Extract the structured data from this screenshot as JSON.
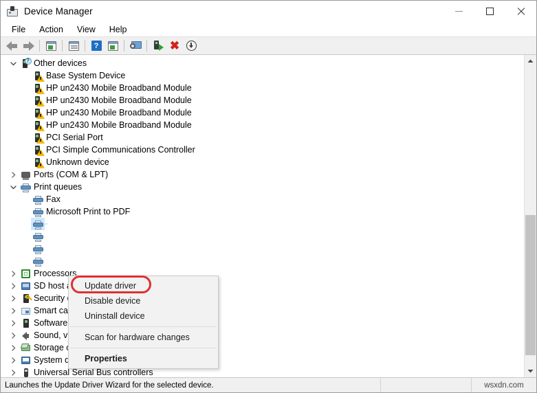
{
  "window": {
    "title": "Device Manager",
    "icon": "device-manager-icon",
    "minimize_label": "Minimize",
    "maximize_label": "Maximize",
    "close_label": "Close"
  },
  "menubar": {
    "items": [
      {
        "label": "File"
      },
      {
        "label": "Action"
      },
      {
        "label": "View"
      },
      {
        "label": "Help"
      }
    ]
  },
  "toolbar": {
    "buttons": [
      {
        "name": "back-arrow-icon",
        "tooltip": "Back"
      },
      {
        "name": "forward-arrow-icon",
        "tooltip": "Forward"
      },
      {
        "name": "show-hide-console-tree-icon",
        "tooltip": "Show/Hide Console Tree"
      },
      {
        "name": "properties-icon",
        "tooltip": "Properties"
      },
      {
        "name": "help-icon",
        "tooltip": "Help"
      },
      {
        "name": "view-icon",
        "tooltip": "View"
      },
      {
        "name": "scan-for-hardware-changes-monitor-icon",
        "tooltip": "Scan for hardware changes"
      },
      {
        "name": "update-driver-icon",
        "tooltip": "Update Driver Software"
      },
      {
        "name": "uninstall-device-icon",
        "tooltip": "Uninstall device"
      },
      {
        "name": "disable-device-icon",
        "tooltip": "Disable device"
      }
    ]
  },
  "tree": {
    "rows": [
      {
        "label": "Other devices",
        "indent": 1,
        "expander": "expanded",
        "icon": "unknown-device-icon",
        "badge": "question"
      },
      {
        "label": "Base System Device",
        "indent": 2,
        "expander": "none",
        "icon": "unknown-device-icon",
        "badge": "warning"
      },
      {
        "label": "HP un2430 Mobile Broadband Module",
        "indent": 2,
        "expander": "none",
        "icon": "unknown-device-icon",
        "badge": "warning"
      },
      {
        "label": "HP un2430 Mobile Broadband Module",
        "indent": 2,
        "expander": "none",
        "icon": "unknown-device-icon",
        "badge": "warning"
      },
      {
        "label": "HP un2430 Mobile Broadband Module",
        "indent": 2,
        "expander": "none",
        "icon": "unknown-device-icon",
        "badge": "warning"
      },
      {
        "label": "HP un2430 Mobile Broadband Module",
        "indent": 2,
        "expander": "none",
        "icon": "unknown-device-icon",
        "badge": "warning"
      },
      {
        "label": "PCI Serial Port",
        "indent": 2,
        "expander": "none",
        "icon": "unknown-device-icon",
        "badge": "warning"
      },
      {
        "label": "PCI Simple Communications Controller",
        "indent": 2,
        "expander": "none",
        "icon": "unknown-device-icon",
        "badge": "warning"
      },
      {
        "label": "Unknown device",
        "indent": 2,
        "expander": "none",
        "icon": "unknown-device-icon",
        "badge": "warning"
      },
      {
        "label": "Ports (COM & LPT)",
        "indent": 1,
        "expander": "collapsed",
        "icon": "port-icon",
        "badge": "none"
      },
      {
        "label": "Print queues",
        "indent": 1,
        "expander": "expanded",
        "icon": "printer-icon",
        "badge": "none"
      },
      {
        "label": "Fax",
        "indent": 2,
        "expander": "none",
        "icon": "printer-icon",
        "badge": "none"
      },
      {
        "label": "Microsoft Print to PDF",
        "indent": 2,
        "expander": "none",
        "icon": "printer-icon",
        "badge": "none"
      },
      {
        "label": "",
        "indent": 2,
        "expander": "none",
        "icon": "printer-icon",
        "badge": "none",
        "selected": true
      },
      {
        "label": "",
        "indent": 2,
        "expander": "none",
        "icon": "printer-icon",
        "badge": "none"
      },
      {
        "label": "",
        "indent": 2,
        "expander": "none",
        "icon": "printer-icon",
        "badge": "none"
      },
      {
        "label": "",
        "indent": 2,
        "expander": "none",
        "icon": "printer-icon",
        "badge": "none"
      },
      {
        "label": "Processors",
        "indent": 1,
        "expander": "collapsed",
        "icon": "processor-icon",
        "badge": "none"
      },
      {
        "label": "SD host adapters",
        "indent": 1,
        "expander": "collapsed",
        "icon": "sd-host-adapter-icon",
        "badge": "none"
      },
      {
        "label": "Security devices",
        "indent": 1,
        "expander": "collapsed",
        "icon": "security-device-icon",
        "badge": "none"
      },
      {
        "label": "Smart card readers",
        "indent": 1,
        "expander": "collapsed",
        "icon": "smart-card-reader-icon",
        "badge": "none"
      },
      {
        "label": "Software devices",
        "indent": 1,
        "expander": "collapsed",
        "icon": "software-device-icon",
        "badge": "none"
      },
      {
        "label": "Sound, video and game controllers",
        "indent": 1,
        "expander": "collapsed",
        "icon": "speaker-icon",
        "badge": "none"
      },
      {
        "label": "Storage controllers",
        "indent": 1,
        "expander": "collapsed",
        "icon": "storage-controller-icon",
        "badge": "none"
      },
      {
        "label": "System devices",
        "indent": 1,
        "expander": "collapsed",
        "icon": "system-device-icon",
        "badge": "none"
      },
      {
        "label": "Universal Serial Bus controllers",
        "indent": 1,
        "expander": "collapsed",
        "icon": "usb-icon",
        "badge": "none"
      }
    ]
  },
  "context_menu": {
    "items": [
      {
        "label": "Update driver",
        "bold": false,
        "highlighted": true
      },
      {
        "label": "Disable device",
        "bold": false
      },
      {
        "label": "Uninstall device",
        "bold": false
      },
      {
        "separator": true
      },
      {
        "label": "Scan for hardware changes",
        "bold": false
      },
      {
        "separator": true
      },
      {
        "label": "Properties",
        "bold": true
      }
    ],
    "highlight_color": "#e03030"
  },
  "statusbar": {
    "message": "Launches the Update Driver Wizard for the selected device.",
    "middle": "",
    "watermark": "wsxdn.com"
  },
  "colors": {
    "selection": "#cde8ff",
    "toolbar_bg": "#f0f0f0",
    "menu_bg": "#f2f2f2",
    "highlight_red": "#e03030",
    "warning_yellow": "#f2b705"
  }
}
